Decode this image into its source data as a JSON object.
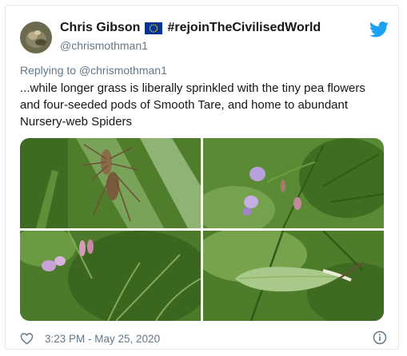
{
  "tweet": {
    "author": {
      "name": "Chris Gibson",
      "flag_icon": "eu-flag-icon",
      "hashtag": "#rejoinTheCivilisedWorld",
      "handle": "@chrismothman1"
    },
    "reply_prefix": "Replying to",
    "reply_to": "@chrismothman1",
    "text": "...while longer grass is liberally sprinkled with the tiny pea flowers and four-seeded pods of Smooth Tare, and home to abundant Nursery-web Spiders",
    "timestamp": "3:23 PM - May 25, 2020",
    "media_count": 4
  },
  "icons": {
    "brand": "twitter-bird-icon",
    "like": "heart-icon",
    "info": "info-icon"
  },
  "colors": {
    "text": "#14171a",
    "secondary": "#657786",
    "twitter_blue": "#1da1f2",
    "border": "#e1e8ed",
    "eu_blue": "#003399",
    "eu_stars": "#ffcc00"
  }
}
